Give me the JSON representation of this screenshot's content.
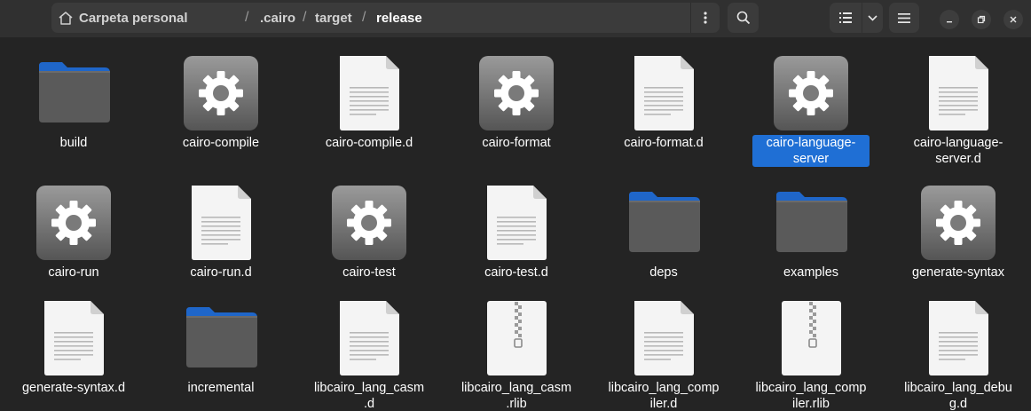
{
  "window": {
    "breadcrumb": [
      "Carpeta personal",
      ".cairo",
      "target",
      "release"
    ],
    "separator": "/",
    "icons": {
      "home": "home-icon",
      "path_menu": "vertical-dots-icon",
      "search": "search-icon",
      "view_list": "list-view-icon",
      "view_dropdown": "chevron-down-icon",
      "main_menu": "hamburger-menu-icon",
      "minimize": "minimize-icon",
      "maximize": "maximize-icon",
      "close": "close-icon"
    }
  },
  "files": [
    {
      "label": "build",
      "kind": "folder"
    },
    {
      "label": "cairo-compile",
      "kind": "executable"
    },
    {
      "label": "cairo-compile.d",
      "kind": "text"
    },
    {
      "label": "cairo-format",
      "kind": "executable"
    },
    {
      "label": "cairo-format.d",
      "kind": "text"
    },
    {
      "label": "cairo-language-server",
      "kind": "executable",
      "selected": true
    },
    {
      "label": "cairo-language-server.d",
      "kind": "text"
    },
    {
      "label": "cairo-run",
      "kind": "executable"
    },
    {
      "label": "cairo-run.d",
      "kind": "text"
    },
    {
      "label": "cairo-test",
      "kind": "executable"
    },
    {
      "label": "cairo-test.d",
      "kind": "text"
    },
    {
      "label": "deps",
      "kind": "folder"
    },
    {
      "label": "examples",
      "kind": "folder"
    },
    {
      "label": "generate-syntax",
      "kind": "executable"
    },
    {
      "label": "generate-syntax.d",
      "kind": "text"
    },
    {
      "label": "incremental",
      "kind": "folder"
    },
    {
      "label": "libcairo_lang_casm.d",
      "kind": "text"
    },
    {
      "label": "libcairo_lang_casm.rlib",
      "kind": "archive"
    },
    {
      "label": "libcairo_lang_compiler.d",
      "kind": "text"
    },
    {
      "label": "libcairo_lang_compiler.rlib",
      "kind": "archive"
    },
    {
      "label": "libcairo_lang_debug.d",
      "kind": "text"
    }
  ],
  "colors": {
    "background": "#242424",
    "headerbar": "#303030",
    "selection": "#1f6fd5",
    "folder_tab": "#1f66c9",
    "folder_body": "#5a5a5a"
  }
}
